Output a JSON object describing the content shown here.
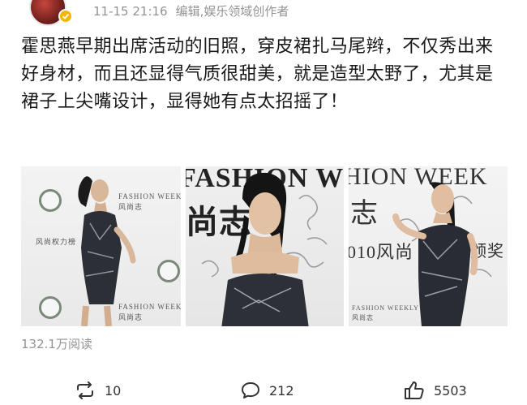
{
  "post": {
    "time": "11-15 21:16",
    "source": "编辑,娱乐领域创作者",
    "text": "霍思燕早期出席活动的旧照，穿皮裙扎马尾辫，不仅秀出来好身材，而且还显得气质很甜美，就是造型太野了，尤其是裙子上尖嘴设计，显得她有点太招摇了！",
    "views": "132.1万阅读"
  },
  "photos": [
    {
      "name": "photo-1",
      "wall_texts": [
        "FASHION WEEKLY",
        "风尚志",
        "风尚权力榜",
        "FASHION WEEKLY",
        "风尚志"
      ]
    },
    {
      "name": "photo-2",
      "wall_texts": [
        "FASHION WE",
        "尚志"
      ]
    },
    {
      "name": "photo-3",
      "wall_texts": [
        "HION WEEK",
        "志",
        "010风尚",
        "颁奖",
        "FASHION WEEKLY",
        "风尚志"
      ]
    }
  ],
  "actions": {
    "repost_count": "10",
    "comment_count": "212",
    "like_count": "5503"
  },
  "colors": {
    "meta_text": "#939393",
    "body_text": "#1a1a1a",
    "verified_badge": "#f7b500"
  },
  "icons": [
    "verified-icon",
    "repost-icon",
    "comment-icon",
    "like-icon"
  ]
}
